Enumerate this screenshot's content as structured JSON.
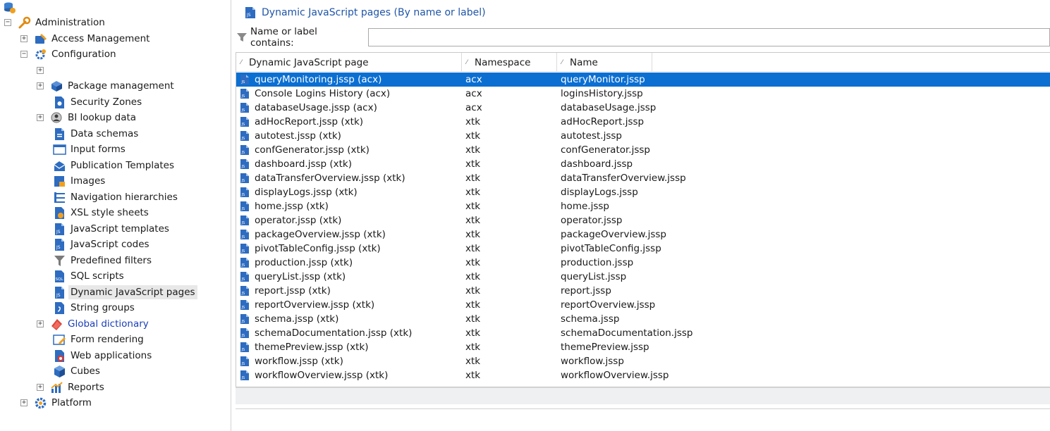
{
  "tree": {
    "root": {
      "label": "Administration"
    },
    "items": [
      {
        "label": "Access Management",
        "icon": "access-management-icon"
      },
      {
        "label": "Configuration",
        "icon": "gear-icon"
      },
      {
        "label": "",
        "icon": ""
      },
      {
        "label": "Package management",
        "icon": "package-icon"
      },
      {
        "label": "Security Zones",
        "icon": "security-zone-icon"
      },
      {
        "label": "BI lookup data",
        "icon": "bi-lookup-icon"
      },
      {
        "label": "Data schemas",
        "icon": "schema-doc-icon"
      },
      {
        "label": "Input forms",
        "icon": "form-icon"
      },
      {
        "label": "Publication Templates",
        "icon": "publication-template-icon"
      },
      {
        "label": "Images",
        "icon": "image-icon"
      },
      {
        "label": "Navigation hierarchies",
        "icon": "navigation-hierarchy-icon"
      },
      {
        "label": "XSL style sheets",
        "icon": "xsl-icon"
      },
      {
        "label": "JavaScript templates",
        "icon": "js-template-icon"
      },
      {
        "label": "JavaScript codes",
        "icon": "js-code-icon"
      },
      {
        "label": "Predefined filters",
        "icon": "filter-icon"
      },
      {
        "label": "SQL scripts",
        "icon": "sql-icon"
      },
      {
        "label": "Dynamic JavaScript pages",
        "icon": "jssp-icon"
      },
      {
        "label": "String groups",
        "icon": "string-group-icon"
      },
      {
        "label": "Global dictionary",
        "icon": "dictionary-icon"
      },
      {
        "label": "Form rendering",
        "icon": "form-rendering-icon"
      },
      {
        "label": "Web applications",
        "icon": "web-application-icon"
      },
      {
        "label": "Cubes",
        "icon": "cube-icon"
      },
      {
        "label": "Reports",
        "icon": "reports-icon"
      },
      {
        "label": "Platform",
        "icon": "platform-gear-icon"
      }
    ]
  },
  "header": {
    "title": "Dynamic JavaScript pages (By name or label)"
  },
  "filter": {
    "label": "Name or label contains:",
    "value": ""
  },
  "grid": {
    "columns": [
      "Dynamic JavaScript page",
      "Namespace",
      "Name"
    ],
    "rows": [
      [
        "queryMonitoring.jssp (acx)",
        "acx",
        "queryMonitor.jssp"
      ],
      [
        "Console Logins History (acx)",
        "acx",
        "loginsHistory.jssp"
      ],
      [
        "databaseUsage.jssp (acx)",
        "acx",
        "databaseUsage.jssp"
      ],
      [
        "adHocReport.jssp (xtk)",
        "xtk",
        "adHocReport.jssp"
      ],
      [
        "autotest.jssp (xtk)",
        "xtk",
        "autotest.jssp"
      ],
      [
        "confGenerator.jssp (xtk)",
        "xtk",
        "confGenerator.jssp"
      ],
      [
        "dashboard.jssp (xtk)",
        "xtk",
        "dashboard.jssp"
      ],
      [
        "dataTransferOverview.jssp (xtk)",
        "xtk",
        "dataTransferOverview.jssp"
      ],
      [
        "displayLogs.jssp (xtk)",
        "xtk",
        "displayLogs.jssp"
      ],
      [
        "home.jssp (xtk)",
        "xtk",
        "home.jssp"
      ],
      [
        "operator.jssp (xtk)",
        "xtk",
        "operator.jssp"
      ],
      [
        "packageOverview.jssp (xtk)",
        "xtk",
        "packageOverview.jssp"
      ],
      [
        "pivotTableConfig.jssp (xtk)",
        "xtk",
        "pivotTableConfig.jssp"
      ],
      [
        "production.jssp (xtk)",
        "xtk",
        "production.jssp"
      ],
      [
        "queryList.jssp (xtk)",
        "xtk",
        "queryList.jssp"
      ],
      [
        "report.jssp (xtk)",
        "xtk",
        "report.jssp"
      ],
      [
        "reportOverview.jssp (xtk)",
        "xtk",
        "reportOverview.jssp"
      ],
      [
        "schema.jssp (xtk)",
        "xtk",
        "schema.jssp"
      ],
      [
        "schemaDocumentation.jssp (xtk)",
        "xtk",
        "schemaDocumentation.jssp"
      ],
      [
        "themePreview.jssp (xtk)",
        "xtk",
        "themePreview.jssp"
      ],
      [
        "workflow.jssp (xtk)",
        "xtk",
        "workflow.jssp"
      ],
      [
        "workflowOverview.jssp (xtk)",
        "xtk",
        "workflowOverview.jssp"
      ]
    ],
    "selected_row": 0
  },
  "colors": {
    "selection": "#0b6fd2",
    "title": "#1f55a8",
    "link": "#1a3fb8"
  }
}
